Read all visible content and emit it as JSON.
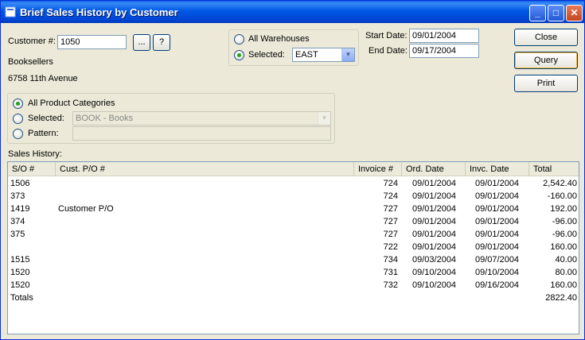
{
  "window": {
    "title": "Brief Sales History by Customer"
  },
  "titlebar_buttons": {
    "minimize": "_",
    "maximize": "□",
    "close": "✕"
  },
  "customer": {
    "label": "Customer #:",
    "number": "1050",
    "browse_label": "...",
    "help_label": "?",
    "name": "Booksellers",
    "address": "6758 11th Avenue"
  },
  "warehouses": {
    "all_label": "All Warehouses",
    "selected_label": "Selected:",
    "selected_value": "EAST",
    "mode": "selected"
  },
  "dates": {
    "start_label": "Start Date:",
    "start_value": "09/01/2004",
    "end_label": "End Date:",
    "end_value": "09/17/2004"
  },
  "buttons": {
    "close": "Close",
    "query": "Query",
    "print": "Print"
  },
  "categories": {
    "all_label": "All Product Categories",
    "selected_label": "Selected:",
    "selected_value": "BOOK - Books",
    "pattern_label": "Pattern:",
    "pattern_value": "",
    "mode": "all"
  },
  "sales_history": {
    "label": "Sales History:",
    "columns": [
      "S/O #",
      "Cust. P/O #",
      "Invoice #",
      "Ord. Date",
      "Invc. Date",
      "Total"
    ],
    "rows": [
      [
        "1506",
        "",
        "724",
        "09/01/2004",
        "09/01/2004",
        "2,542.40"
      ],
      [
        "373",
        "",
        "724",
        "09/01/2004",
        "09/01/2004",
        "-160.00"
      ],
      [
        "1419",
        "Customer P/O",
        "727",
        "09/01/2004",
        "09/01/2004",
        "192.00"
      ],
      [
        "374",
        "",
        "727",
        "09/01/2004",
        "09/01/2004",
        "-96.00"
      ],
      [
        "375",
        "",
        "727",
        "09/01/2004",
        "09/01/2004",
        "-96.00"
      ],
      [
        "",
        "",
        "722",
        "09/01/2004",
        "09/01/2004",
        "160.00"
      ],
      [
        "1515",
        "",
        "734",
        "09/03/2004",
        "09/07/2004",
        "40.00"
      ],
      [
        "1520",
        "",
        "731",
        "09/10/2004",
        "09/10/2004",
        "80.00"
      ],
      [
        "1520",
        "",
        "732",
        "09/10/2004",
        "09/16/2004",
        "160.00"
      ]
    ],
    "totals_label": "Totals",
    "totals_value": "2822.40"
  }
}
